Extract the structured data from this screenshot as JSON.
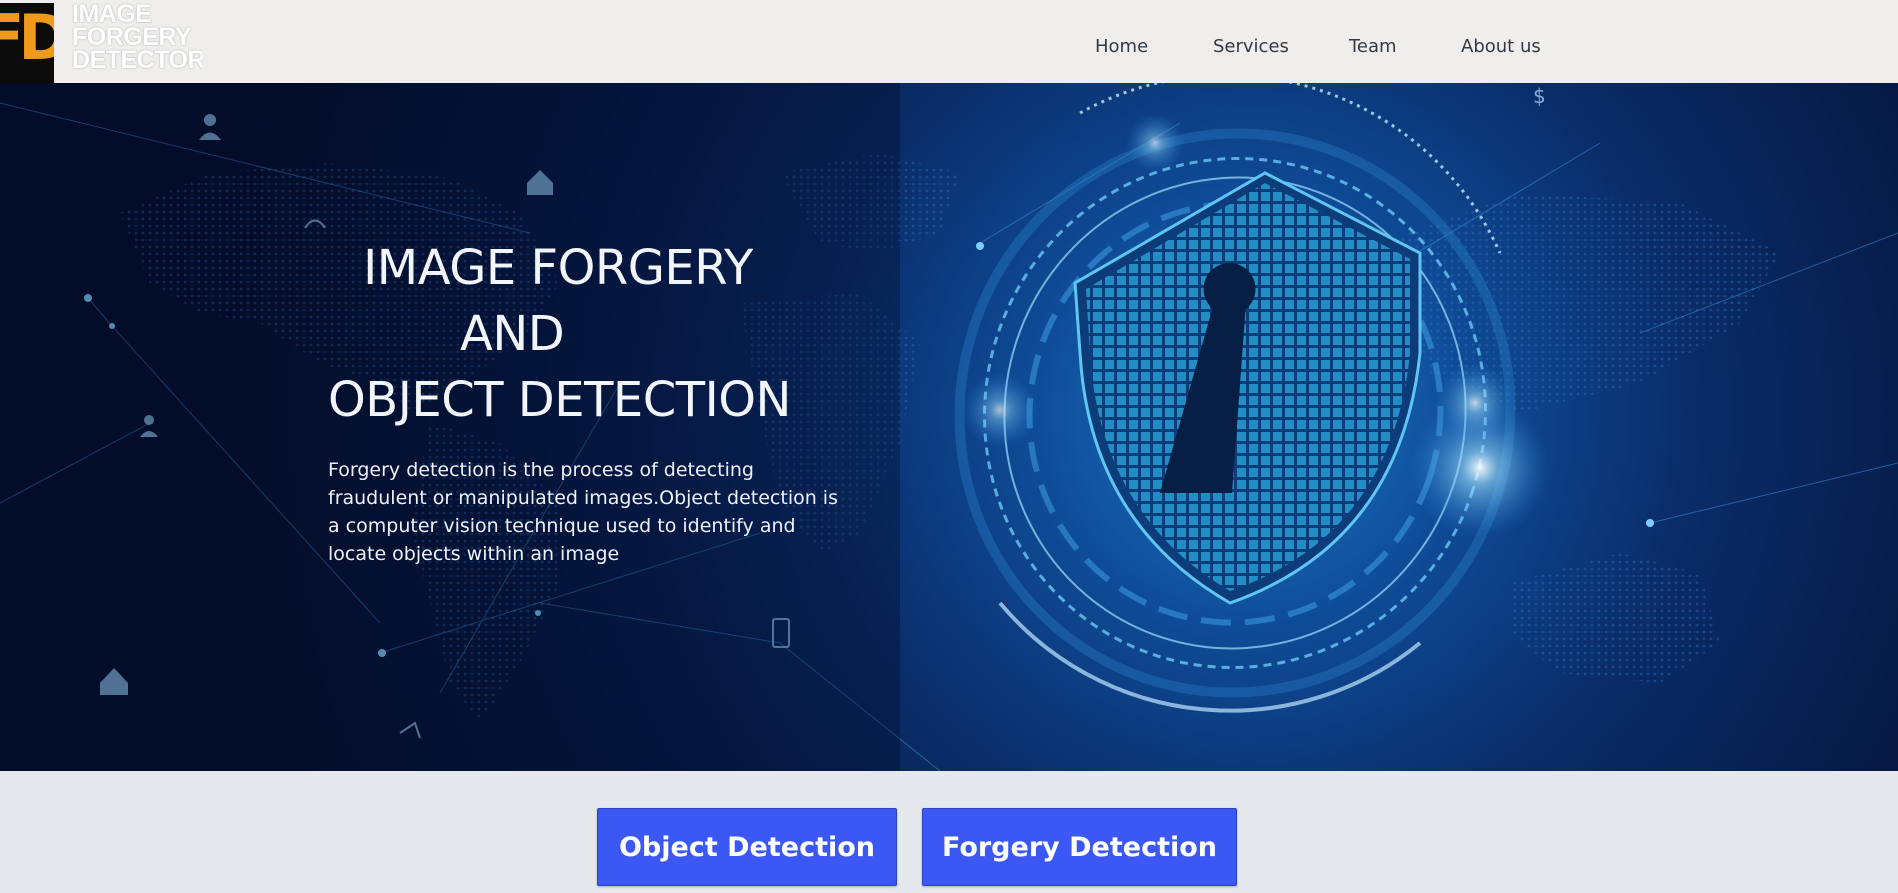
{
  "logo": {
    "mark": "FD",
    "text": "IMAGE\nFORGERY\nDETECTOR"
  },
  "nav": {
    "items": [
      {
        "label": "Home"
      },
      {
        "label": "Services"
      },
      {
        "label": "Team"
      },
      {
        "label": "About us"
      }
    ]
  },
  "hero": {
    "title_line1": "IMAGE FORGERY",
    "title_line2": "AND",
    "title_line3": "OBJECT DETECTION",
    "description": "Forgery detection is the process of detecting fraudulent or manipulated images.Object detection is a computer vision technique used to identify and locate objects within an image"
  },
  "actions": {
    "object_detection_label": "Object Detection",
    "forgery_detection_label": "Forgery Detection"
  },
  "colors": {
    "button": "#3b57f4",
    "hero_dark": "#040f2d",
    "hero_glow": "#1d79c9",
    "logo_accent": "#f09a1c"
  }
}
